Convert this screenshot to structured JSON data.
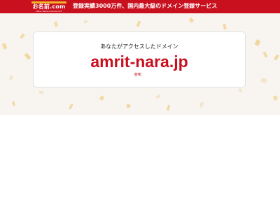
{
  "header": {
    "logo_text": "お名前.com",
    "logo_subtext": "https://www.onamae.com",
    "tagline": "登録実績3000万件、国内最大級のドメイン登録サービス"
  },
  "main_card": {
    "title": "あなたがアクセスしたドメイン",
    "domain": "amrit-nara.jp",
    "meaning": "意味："
  },
  "colors": {
    "brand_red": "#c8101f",
    "background": "#f8f4ef",
    "confetti": "#f3d28c"
  }
}
